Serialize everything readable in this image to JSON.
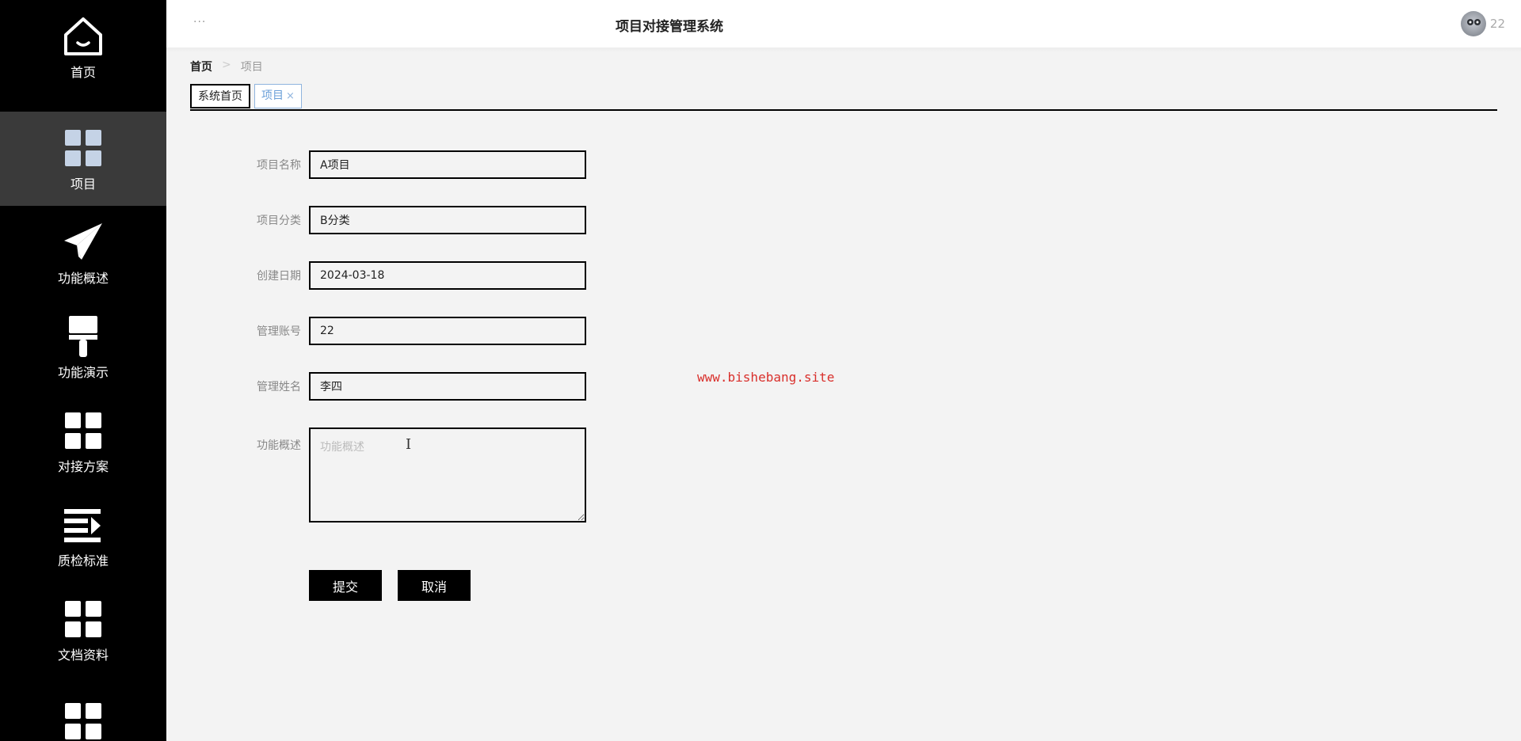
{
  "app": {
    "title": "项目对接管理系统",
    "username": "22"
  },
  "sidebar": {
    "items": [
      {
        "label": "首页",
        "icon": "home-icon",
        "active": false
      },
      {
        "label": "项目",
        "icon": "grid-icon",
        "active": true
      },
      {
        "label": "功能概述",
        "icon": "paper-plane-icon",
        "active": false
      },
      {
        "label": "功能演示",
        "icon": "brush-icon",
        "active": false
      },
      {
        "label": "对接方案",
        "icon": "grid-icon",
        "active": false
      },
      {
        "label": "质检标准",
        "icon": "list-arrow-icon",
        "active": false
      },
      {
        "label": "文档资料",
        "icon": "grid-icon",
        "active": false
      },
      {
        "label": "",
        "icon": "grid-icon",
        "active": false
      }
    ]
  },
  "breadcrumb": {
    "home": "首页",
    "separator": ">",
    "current": "项目"
  },
  "tabs": [
    {
      "label": "系统首页"
    },
    {
      "label": "项目",
      "close": "×"
    }
  ],
  "form": {
    "name": {
      "label": "项目名称",
      "value": "A项目"
    },
    "category": {
      "label": "项目分类",
      "value": "B分类"
    },
    "date": {
      "label": "创建日期",
      "value": "2024-03-18"
    },
    "account": {
      "label": "管理账号",
      "value": "22"
    },
    "manager": {
      "label": "管理姓名",
      "value": "李四"
    },
    "desc": {
      "label": "功能概述",
      "placeholder": "功能概述"
    }
  },
  "buttons": {
    "submit": "提交",
    "cancel": "取消"
  },
  "watermark": "www.bishebang.site",
  "topbar": {
    "menu": "···"
  }
}
